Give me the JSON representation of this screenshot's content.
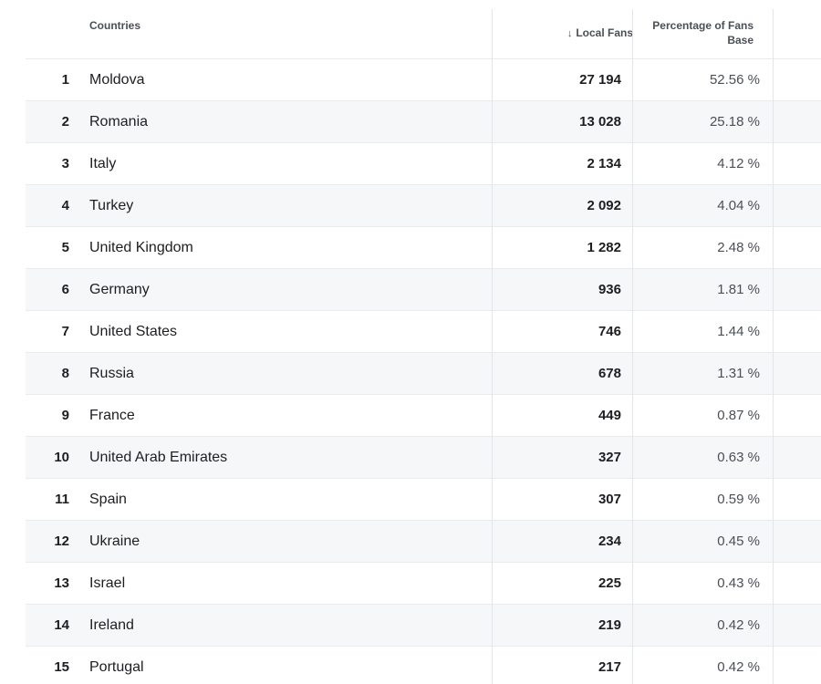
{
  "table": {
    "headers": {
      "countries": "Countries",
      "local_fans": "Local Fans",
      "local_fans_sort_icon": "sort-descending-arrow-icon",
      "percentage_line1": "Percentage of Fans",
      "percentage_line2": "Base"
    },
    "rows": [
      {
        "rank": "1",
        "country": "Moldova",
        "fans": "27 194",
        "pct": "52.56 %"
      },
      {
        "rank": "2",
        "country": "Romania",
        "fans": "13 028",
        "pct": "25.18 %"
      },
      {
        "rank": "3",
        "country": "Italy",
        "fans": "2 134",
        "pct": "4.12 %"
      },
      {
        "rank": "4",
        "country": "Turkey",
        "fans": "2 092",
        "pct": "4.04 %"
      },
      {
        "rank": "5",
        "country": "United Kingdom",
        "fans": "1 282",
        "pct": "2.48 %"
      },
      {
        "rank": "6",
        "country": "Germany",
        "fans": "936",
        "pct": "1.81 %"
      },
      {
        "rank": "7",
        "country": "United States",
        "fans": "746",
        "pct": "1.44 %"
      },
      {
        "rank": "8",
        "country": "Russia",
        "fans": "678",
        "pct": "1.31 %"
      },
      {
        "rank": "9",
        "country": "France",
        "fans": "449",
        "pct": "0.87 %"
      },
      {
        "rank": "10",
        "country": "United Arab Emirates",
        "fans": "327",
        "pct": "0.63 %"
      },
      {
        "rank": "11",
        "country": "Spain",
        "fans": "307",
        "pct": "0.59 %"
      },
      {
        "rank": "12",
        "country": "Ukraine",
        "fans": "234",
        "pct": "0.45 %"
      },
      {
        "rank": "13",
        "country": "Israel",
        "fans": "225",
        "pct": "0.43 %"
      },
      {
        "rank": "14",
        "country": "Ireland",
        "fans": "219",
        "pct": "0.42 %"
      },
      {
        "rank": "15",
        "country": "Portugal",
        "fans": "217",
        "pct": "0.42 %"
      }
    ]
  },
  "colors": {
    "row_alt_background": "#f6f7f9",
    "border": "#e9ebee",
    "text_primary": "#1c1e21",
    "text_secondary": "#4b4f56"
  }
}
